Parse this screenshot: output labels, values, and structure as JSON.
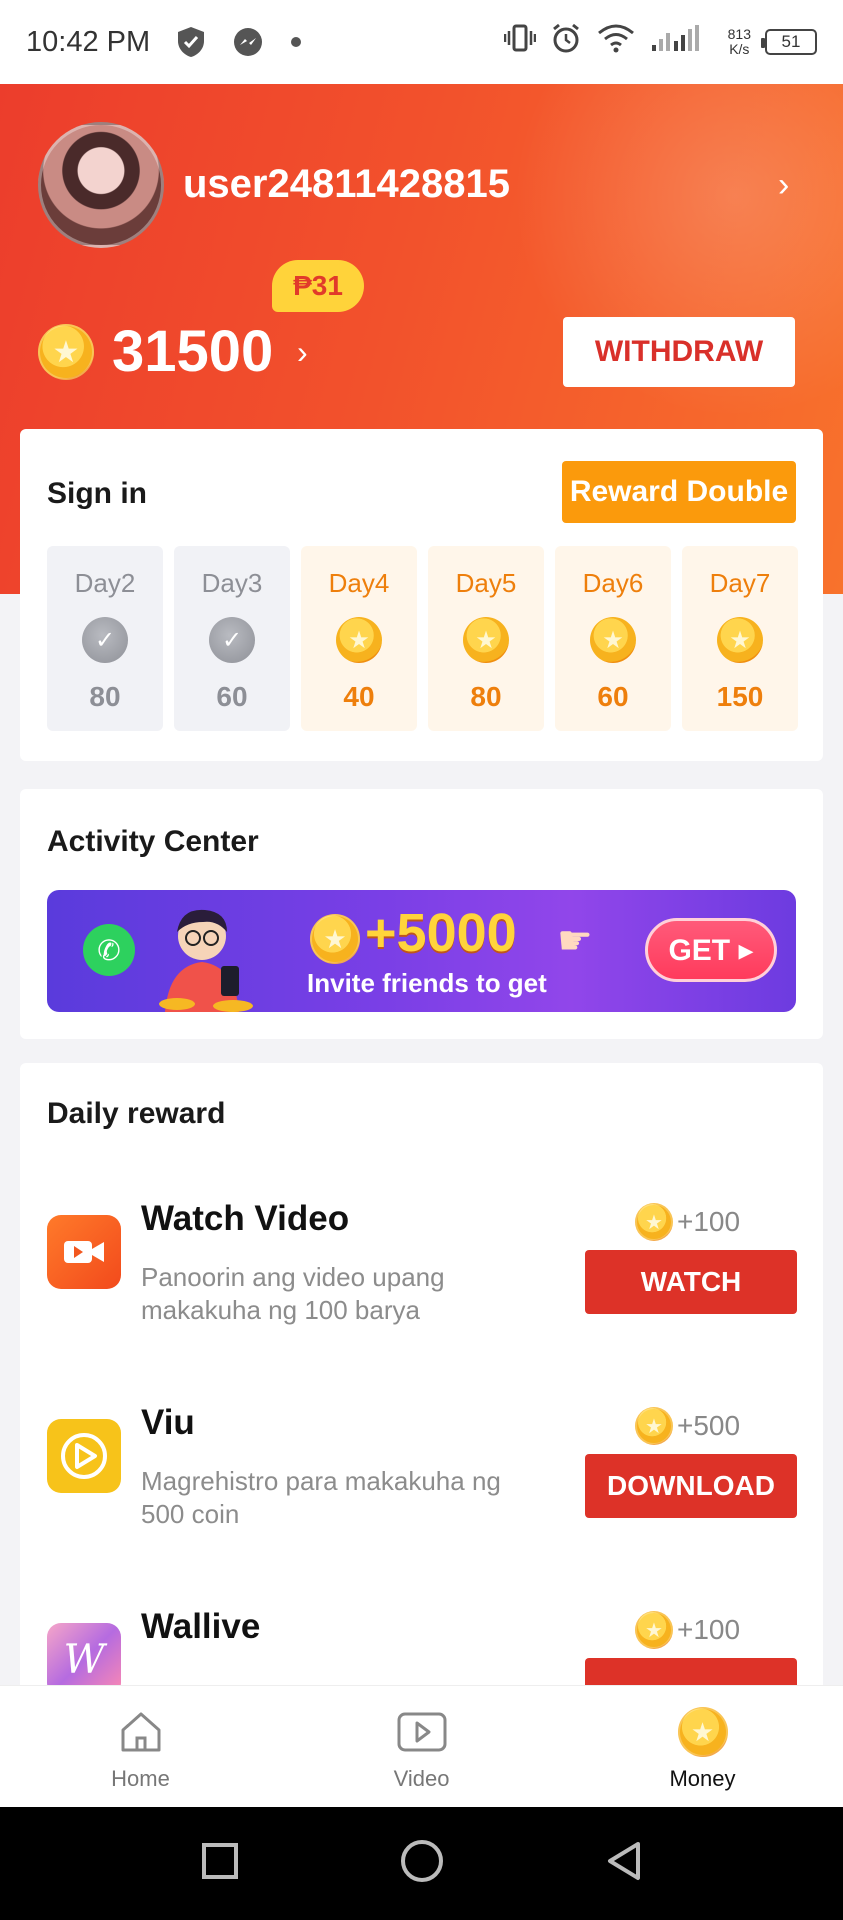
{
  "status_bar": {
    "time": "10:42 PM",
    "net_speed_value": "813",
    "net_speed_unit": "K/s",
    "battery": "51"
  },
  "profile": {
    "username": "user24811428815",
    "peso_badge": "₱31",
    "balance": "31500",
    "withdraw_label": "WITHDRAW"
  },
  "signin": {
    "title": "Sign in",
    "reward_double_label": "Reward Double",
    "days": [
      {
        "name": "Day2",
        "value": "80",
        "claimed": true
      },
      {
        "name": "Day3",
        "value": "60",
        "claimed": true
      },
      {
        "name": "Day4",
        "value": "40",
        "claimed": false
      },
      {
        "name": "Day5",
        "value": "80",
        "claimed": false
      },
      {
        "name": "Day6",
        "value": "60",
        "claimed": false
      },
      {
        "name": "Day7",
        "value": "150",
        "claimed": false
      }
    ]
  },
  "activity": {
    "title": "Activity Center",
    "banner_amount": "+5000",
    "banner_text": "Invite friends to get",
    "banner_button": "GET ▸"
  },
  "daily_reward": {
    "title": "Daily reward",
    "tasks": [
      {
        "name": "Watch Video",
        "description": "Panoorin ang video upang makakuha ng 100 barya",
        "reward": "+100",
        "button": "WATCH",
        "icon": "video-camera-icon",
        "color": "#f2571f"
      },
      {
        "name": "Viu",
        "description": "Magrehistro para makakuha ng 500 coin",
        "reward": "+500",
        "button": "DOWNLOAD",
        "icon": "viu-play-icon",
        "color": "#f7c31a"
      },
      {
        "name": "Wallive",
        "description": "",
        "reward": "+100",
        "button": "",
        "icon": "wallive-w-icon",
        "color": "#e86ba9"
      }
    ]
  },
  "bottom_nav": {
    "items": [
      {
        "label": "Home",
        "icon": "home-icon",
        "active": false
      },
      {
        "label": "Video",
        "icon": "video-play-icon",
        "active": false
      },
      {
        "label": "Money",
        "icon": "coin-icon",
        "active": true
      }
    ]
  },
  "colors": {
    "header_red": "#ec3d2c",
    "header_orange": "#f8722c",
    "action_red": "#dd3228",
    "reward_orange": "#fb9a0c",
    "coin_gold": "#f7b21e"
  }
}
